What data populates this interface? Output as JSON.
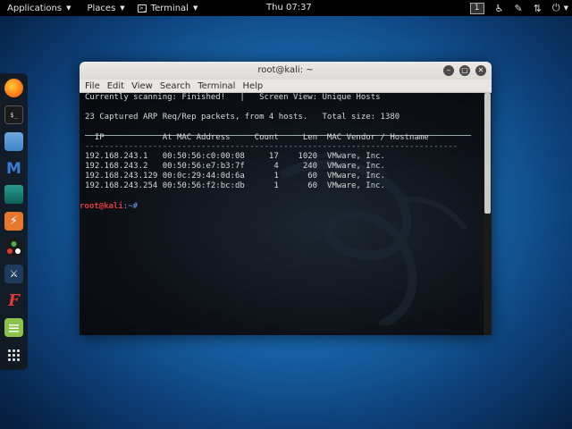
{
  "topbar": {
    "applications": "Applications",
    "places": "Places",
    "terminal": "Terminal",
    "clock": "Thu 07:37",
    "workspace": "1"
  },
  "window": {
    "title": "root@kali: ~",
    "menu": [
      "File",
      "Edit",
      "View",
      "Search",
      "Terminal",
      "Help"
    ]
  },
  "terminal": {
    "status_line": "Currently scanning: Finished!   |   Screen View: Unique Hosts",
    "summary_line": "23 Captured ARP Req/Rep packets, from 4 hosts.   Total size: 1380",
    "header": "  IP            At MAC Address     Count     Len  MAC Vendor / Hostname",
    "separator": "-----------------------------------------------------------------------------",
    "rows": [
      "192.168.243.1   00:50:56:c0:00:08     17    1020  VMware, Inc.",
      "192.168.243.2   00:50:56:e7:b3:7f      4     240  VMware, Inc.",
      "192.168.243.129 00:0c:29:44:0d:6a      1      60  VMware, Inc.",
      "192.168.243.254 00:50:56:f2:bc:db      1      60  VMware, Inc."
    ],
    "prompt_user": "root@kali",
    "prompt_path": ":~#"
  },
  "icons": {
    "dock": [
      "firefox-icon",
      "terminal-icon",
      "files-icon",
      "metasploit-icon",
      "armitage-icon",
      "burpsuite-icon",
      "maltego-icon",
      "beef-icon",
      "faraday-icon",
      "notes-icon",
      "show-apps-icon"
    ],
    "topbar": [
      "accessibility-icon",
      "settings-icon",
      "network-icon",
      "power-icon"
    ]
  }
}
